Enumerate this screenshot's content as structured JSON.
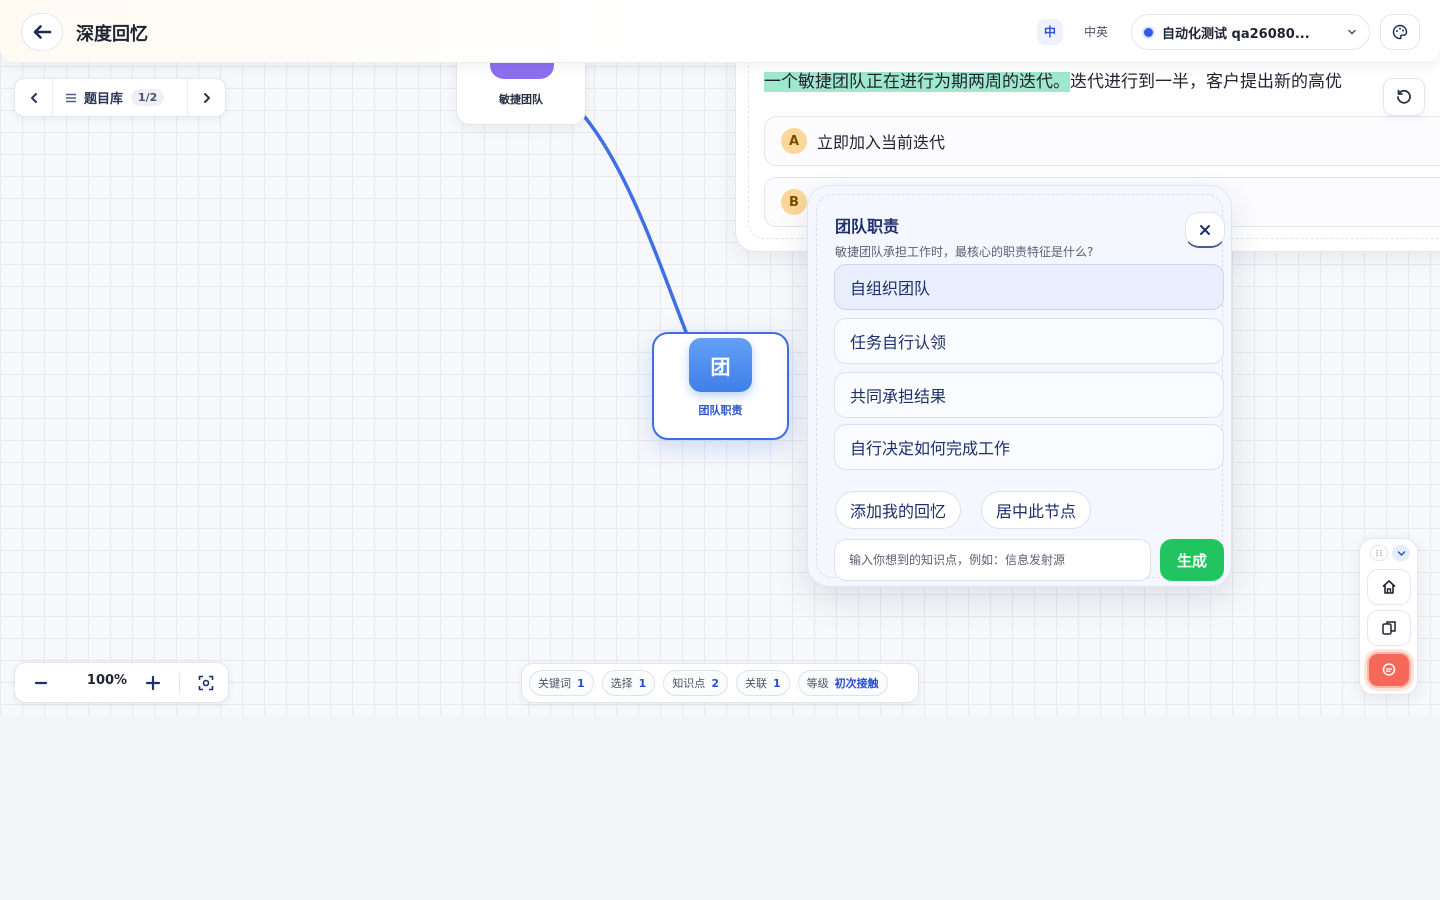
{
  "header": {
    "title": "深度回忆",
    "lang_zh": "中",
    "lang_mix": "中英",
    "account": "自动化测试 qa26080..."
  },
  "qbank": {
    "label": "题目库",
    "count": "1/2"
  },
  "nodes": {
    "parent_label": "敏捷团队",
    "active_label": "团队职责",
    "active_icon_text": "团"
  },
  "question": {
    "highlight": "一个敏捷团队正在进行为期两周的迭代。",
    "rest": "迭代进行到一半，客户提出新的高优",
    "option_a_key": "A",
    "option_a_text": "立即加入当前迭代",
    "option_b_key": "B"
  },
  "popup": {
    "title": "团队职责",
    "subtitle": "敏捷团队承担工作时，最核心的职责特征是什么?",
    "choices": [
      "自组织团队",
      "任务自行认领",
      "共同承担结果",
      "自行决定如何完成工作"
    ],
    "add_memory": "添加我的回忆",
    "center_node": "居中此节点",
    "input_placeholder": "输入你想到的知识点，例如：信息发射源",
    "generate": "生成"
  },
  "zoom": {
    "value": "100%"
  },
  "stats": [
    {
      "label": "关键词",
      "value": "1"
    },
    {
      "label": "选择",
      "value": "1"
    },
    {
      "label": "知识点",
      "value": "2"
    },
    {
      "label": "关联",
      "value": "1"
    },
    {
      "label": "等级",
      "value": "初次接触"
    }
  ],
  "icons": {
    "back": "arrow-left-icon",
    "palette": "palette-icon",
    "list": "list-icon",
    "refresh": "refresh-icon",
    "close": "close-icon",
    "home": "home-icon",
    "copy": "copy-icon",
    "chat": "chat-icon",
    "fit": "fit-screen-icon"
  },
  "colors": {
    "accent": "#3d6fe6",
    "generate": "#21c45e",
    "highlight": "#9fe7cd",
    "chat_button": "#f6685a"
  }
}
